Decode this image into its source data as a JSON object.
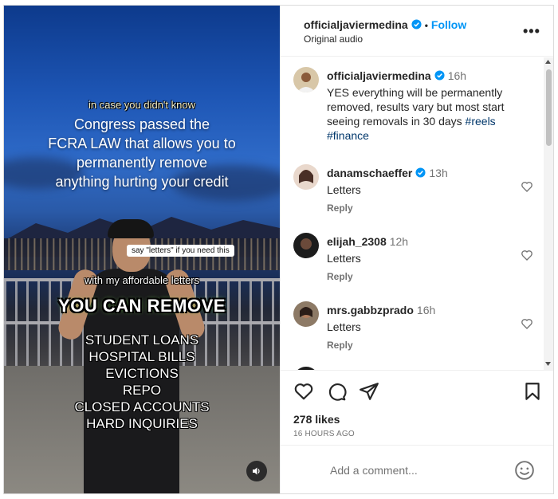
{
  "media": {
    "overlay_small": "in case you didn't know",
    "overlay_heading_lines": [
      "Congress passed the",
      "FCRA LAW that allows you to",
      "permanently remove",
      "anything hurting your credit"
    ],
    "caption_box": "say \"letters\" if you need this",
    "overlay_mid": "with my affordable letters",
    "overlay_big": "YOU CAN REMOVE",
    "overlay_list": [
      "STUDENT LOANS",
      "HOSPITAL BILLS",
      "EVICTIONS",
      "REPO",
      "CLOSED ACCOUNTS",
      "HARD INQUIRIES"
    ],
    "audio_icon": "speaker-icon"
  },
  "header": {
    "username": "officialjaviermedina",
    "dot": "•",
    "follow_label": "Follow",
    "subtitle": "Original audio",
    "more_label": "•••"
  },
  "caption": {
    "username": "officialjaviermedina",
    "time": "16h",
    "text": "YES everything will be permanently removed, results vary but most start seeing removals in 30 days ",
    "tags": [
      "#reels",
      "#finance"
    ]
  },
  "comments": [
    {
      "username": "danamschaeffer",
      "verified": true,
      "time": "13h",
      "text": "Letters",
      "reply_label": "Reply"
    },
    {
      "username": "elijah_2308",
      "verified": false,
      "time": "12h",
      "text": "Letters",
      "reply_label": "Reply"
    },
    {
      "username": "mrs.gabbzprado",
      "verified": false,
      "time": "16h",
      "text": "Letters",
      "reply_label": "Reply"
    }
  ],
  "actions": {
    "icons": [
      "heart-icon",
      "comment-icon",
      "share-icon",
      "bookmark-icon"
    ],
    "likes": "278 likes",
    "timestamp": "16 HOURS AGO"
  },
  "add_comment": {
    "placeholder": "Add a comment...",
    "icon": "emoji-icon"
  },
  "colors": {
    "follow": "#0095f6",
    "verified": "#0095f6",
    "hashtag": "#00376b",
    "muted": "#737373"
  }
}
